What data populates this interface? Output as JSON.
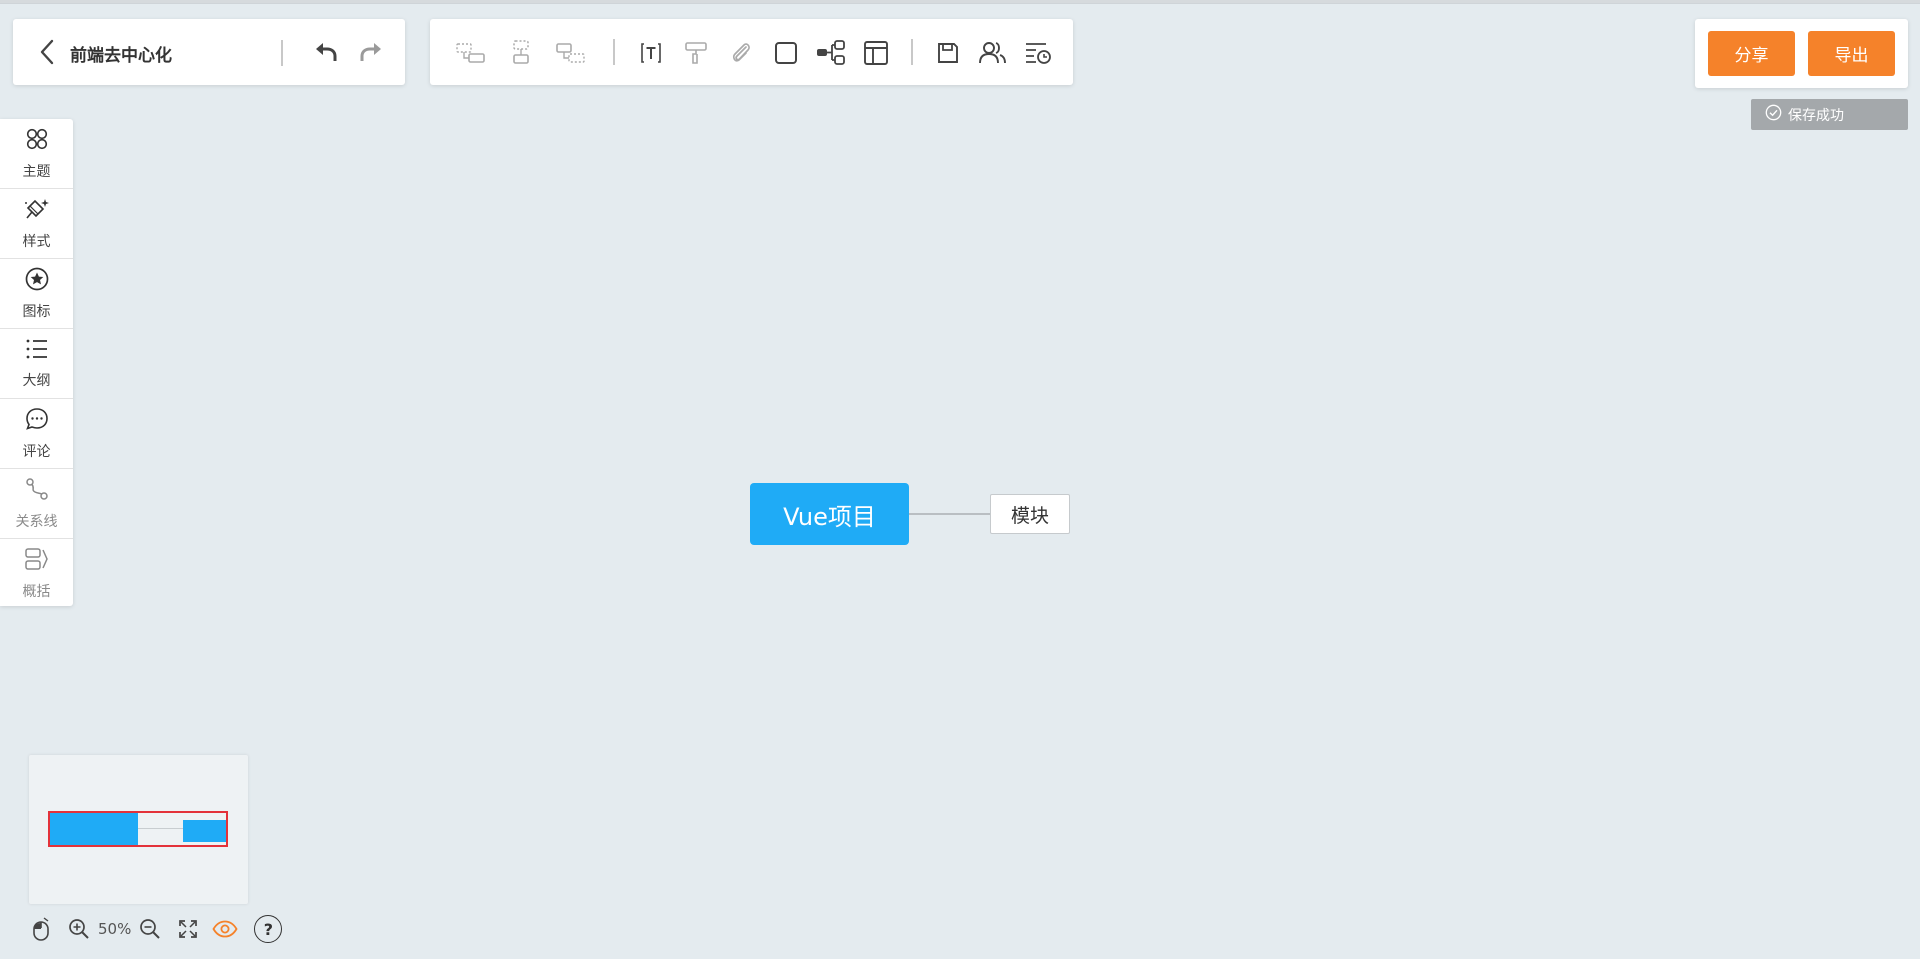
{
  "header": {
    "doc_title": "前端去中心化",
    "back_icon": "chevron-left-icon",
    "undo_icon": "undo-icon",
    "redo_icon": "redo-icon"
  },
  "toolbar": {
    "tools": [
      {
        "name": "insert-sibling-node-icon",
        "enabled": false
      },
      {
        "name": "insert-child-node-icon",
        "enabled": false
      },
      {
        "name": "insert-parent-node-icon",
        "enabled": false
      },
      {
        "name": "text-icon",
        "enabled": true
      },
      {
        "name": "format-painter-icon",
        "enabled": false
      },
      {
        "name": "attachment-icon",
        "enabled": false
      },
      {
        "name": "border-box-icon",
        "enabled": true
      },
      {
        "name": "structure-icon",
        "enabled": true
      },
      {
        "name": "layout-icon",
        "enabled": true
      },
      {
        "name": "save-icon",
        "enabled": true
      },
      {
        "name": "collaborators-icon",
        "enabled": true
      },
      {
        "name": "history-icon",
        "enabled": true
      }
    ]
  },
  "actions": {
    "share_label": "分享",
    "export_label": "导出",
    "save_status": "保存成功"
  },
  "sidebar": {
    "items": [
      {
        "label": "主题",
        "icon": "theme-icon"
      },
      {
        "label": "样式",
        "icon": "style-brush-icon"
      },
      {
        "label": "图标",
        "icon": "star-circle-icon"
      },
      {
        "label": "大纲",
        "icon": "outline-list-icon"
      },
      {
        "label": "评论",
        "icon": "comment-icon"
      },
      {
        "label": "关系线",
        "icon": "relation-line-icon"
      },
      {
        "label": "概括",
        "icon": "summary-icon"
      }
    ]
  },
  "canvas": {
    "root_node": "Vue项目",
    "child_node": "模块"
  },
  "colors": {
    "accent_orange": "#f5822a",
    "node_blue": "#1fabf6",
    "background": "#e4ebef",
    "minimap_frame": "#e3323a"
  },
  "footer": {
    "zoom": "50%",
    "help": "?"
  }
}
